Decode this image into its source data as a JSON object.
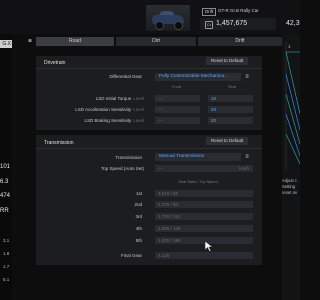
{
  "header": {
    "drift_tag": "Drift",
    "car_name": "GT-R Gr.B Rally Car",
    "credits": "1,457,675",
    "credits_icon": "Cr",
    "mileage": "42,3"
  },
  "left": {
    "active_button": "G.X",
    "values": [
      "101",
      "6.3",
      "474",
      "RR"
    ],
    "small_values": [
      "3.1",
      "1.8",
      "1.7",
      "5.1"
    ]
  },
  "tabs": [
    {
      "label": "Road",
      "active": true
    },
    {
      "label": "Dirt",
      "active": false
    },
    {
      "label": "Drift",
      "active": false
    }
  ],
  "drivetrain": {
    "title": "Drivetrain",
    "reset_label": "Reset to Default",
    "differential_label": "Differential Gear",
    "differential_value": "Fully Customizable Mechanica...",
    "front_header": "Front",
    "rear_header": "Rear",
    "rows": [
      {
        "label": "LSD Initial Torque",
        "level": "Level",
        "front": "---",
        "rear": "10"
      },
      {
        "label": "LSD Acceleration Sensitivity",
        "level": "Level",
        "front": "---",
        "rear": "40"
      },
      {
        "label": "LSD Braking Sensitivity",
        "level": "Level",
        "front": "---",
        "rear": "20"
      }
    ]
  },
  "transmission": {
    "title": "Transmission",
    "reset_label": "Reset to Default",
    "type_label": "Transmission",
    "type_value": "Manual Transmission",
    "top_speed_label": "Top Speed (Auto Set)",
    "top_speed_unit": "km/h",
    "top_speed_value": "---",
    "gear_header": "Gear Ratio / Top Speed",
    "gears": [
      {
        "label": "1st",
        "value": "3.610 / 52"
      },
      {
        "label": "2nd",
        "value": "2.370 / 80"
      },
      {
        "label": "3rd",
        "value": "1.700 / 112"
      },
      {
        "label": "4th",
        "value": "1.300 / 146"
      },
      {
        "label": "5th",
        "value": "1.030 / 186"
      }
    ],
    "final_gear_label": "Final Gear",
    "final_gear_value": "4.125"
  },
  "graph_tip": [
    "Adjust c",
    "Setting",
    "reset an"
  ],
  "colors": {
    "accent_blue": "#5da7ff",
    "graph_teal": "#1fa39a",
    "graph_blue": "#3b82f6",
    "panel": "#1c1d20"
  }
}
